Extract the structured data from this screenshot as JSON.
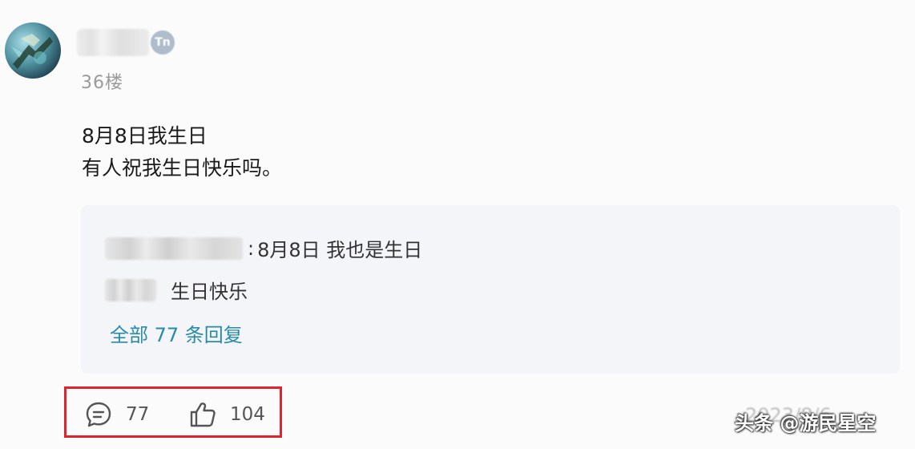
{
  "post": {
    "floor": "36楼",
    "badge_text": "Tn",
    "content_lines": [
      "8月8日我生日",
      "有人祝我生日快乐吗。"
    ]
  },
  "replies": [
    {
      "separator": ":",
      "text": "8月8日 我也是生日"
    },
    {
      "separator": "",
      "text": "生日快乐"
    }
  ],
  "all_replies_label": "全部 77 条回复",
  "actions": {
    "comment_count": "77",
    "like_count": "104"
  },
  "meta": {
    "date_partial": "2023/8/6",
    "watermark": "头条 @游民星空"
  },
  "colors": {
    "link": "#2a8ba8",
    "highlight_frame": "#e0242f",
    "reply_bg": "#f3f5f8"
  },
  "icons": {
    "comment": "comment-icon",
    "like": "thumbs-up-icon",
    "verified": "verified-badge-icon"
  }
}
